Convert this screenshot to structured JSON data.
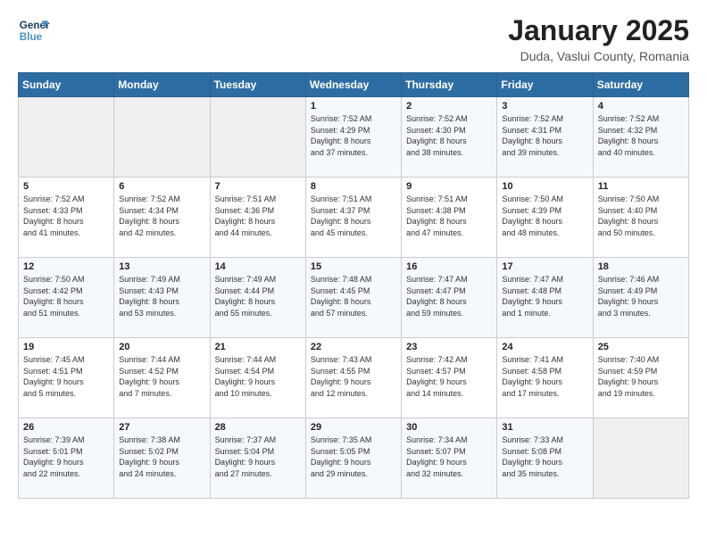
{
  "header": {
    "logo_line1": "General",
    "logo_line2": "Blue",
    "month": "January 2025",
    "location": "Duda, Vaslui County, Romania"
  },
  "days_of_week": [
    "Sunday",
    "Monday",
    "Tuesday",
    "Wednesday",
    "Thursday",
    "Friday",
    "Saturday"
  ],
  "weeks": [
    [
      {
        "day": "",
        "info": ""
      },
      {
        "day": "",
        "info": ""
      },
      {
        "day": "",
        "info": ""
      },
      {
        "day": "1",
        "info": "Sunrise: 7:52 AM\nSunset: 4:29 PM\nDaylight: 8 hours\nand 37 minutes."
      },
      {
        "day": "2",
        "info": "Sunrise: 7:52 AM\nSunset: 4:30 PM\nDaylight: 8 hours\nand 38 minutes."
      },
      {
        "day": "3",
        "info": "Sunrise: 7:52 AM\nSunset: 4:31 PM\nDaylight: 8 hours\nand 39 minutes."
      },
      {
        "day": "4",
        "info": "Sunrise: 7:52 AM\nSunset: 4:32 PM\nDaylight: 8 hours\nand 40 minutes."
      }
    ],
    [
      {
        "day": "5",
        "info": "Sunrise: 7:52 AM\nSunset: 4:33 PM\nDaylight: 8 hours\nand 41 minutes."
      },
      {
        "day": "6",
        "info": "Sunrise: 7:52 AM\nSunset: 4:34 PM\nDaylight: 8 hours\nand 42 minutes."
      },
      {
        "day": "7",
        "info": "Sunrise: 7:51 AM\nSunset: 4:36 PM\nDaylight: 8 hours\nand 44 minutes."
      },
      {
        "day": "8",
        "info": "Sunrise: 7:51 AM\nSunset: 4:37 PM\nDaylight: 8 hours\nand 45 minutes."
      },
      {
        "day": "9",
        "info": "Sunrise: 7:51 AM\nSunset: 4:38 PM\nDaylight: 8 hours\nand 47 minutes."
      },
      {
        "day": "10",
        "info": "Sunrise: 7:50 AM\nSunset: 4:39 PM\nDaylight: 8 hours\nand 48 minutes."
      },
      {
        "day": "11",
        "info": "Sunrise: 7:50 AM\nSunset: 4:40 PM\nDaylight: 8 hours\nand 50 minutes."
      }
    ],
    [
      {
        "day": "12",
        "info": "Sunrise: 7:50 AM\nSunset: 4:42 PM\nDaylight: 8 hours\nand 51 minutes."
      },
      {
        "day": "13",
        "info": "Sunrise: 7:49 AM\nSunset: 4:43 PM\nDaylight: 8 hours\nand 53 minutes."
      },
      {
        "day": "14",
        "info": "Sunrise: 7:49 AM\nSunset: 4:44 PM\nDaylight: 8 hours\nand 55 minutes."
      },
      {
        "day": "15",
        "info": "Sunrise: 7:48 AM\nSunset: 4:45 PM\nDaylight: 8 hours\nand 57 minutes."
      },
      {
        "day": "16",
        "info": "Sunrise: 7:47 AM\nSunset: 4:47 PM\nDaylight: 8 hours\nand 59 minutes."
      },
      {
        "day": "17",
        "info": "Sunrise: 7:47 AM\nSunset: 4:48 PM\nDaylight: 9 hours\nand 1 minute."
      },
      {
        "day": "18",
        "info": "Sunrise: 7:46 AM\nSunset: 4:49 PM\nDaylight: 9 hours\nand 3 minutes."
      }
    ],
    [
      {
        "day": "19",
        "info": "Sunrise: 7:45 AM\nSunset: 4:51 PM\nDaylight: 9 hours\nand 5 minutes."
      },
      {
        "day": "20",
        "info": "Sunrise: 7:44 AM\nSunset: 4:52 PM\nDaylight: 9 hours\nand 7 minutes."
      },
      {
        "day": "21",
        "info": "Sunrise: 7:44 AM\nSunset: 4:54 PM\nDaylight: 9 hours\nand 10 minutes."
      },
      {
        "day": "22",
        "info": "Sunrise: 7:43 AM\nSunset: 4:55 PM\nDaylight: 9 hours\nand 12 minutes."
      },
      {
        "day": "23",
        "info": "Sunrise: 7:42 AM\nSunset: 4:57 PM\nDaylight: 9 hours\nand 14 minutes."
      },
      {
        "day": "24",
        "info": "Sunrise: 7:41 AM\nSunset: 4:58 PM\nDaylight: 9 hours\nand 17 minutes."
      },
      {
        "day": "25",
        "info": "Sunrise: 7:40 AM\nSunset: 4:59 PM\nDaylight: 9 hours\nand 19 minutes."
      }
    ],
    [
      {
        "day": "26",
        "info": "Sunrise: 7:39 AM\nSunset: 5:01 PM\nDaylight: 9 hours\nand 22 minutes."
      },
      {
        "day": "27",
        "info": "Sunrise: 7:38 AM\nSunset: 5:02 PM\nDaylight: 9 hours\nand 24 minutes."
      },
      {
        "day": "28",
        "info": "Sunrise: 7:37 AM\nSunset: 5:04 PM\nDaylight: 9 hours\nand 27 minutes."
      },
      {
        "day": "29",
        "info": "Sunrise: 7:35 AM\nSunset: 5:05 PM\nDaylight: 9 hours\nand 29 minutes."
      },
      {
        "day": "30",
        "info": "Sunrise: 7:34 AM\nSunset: 5:07 PM\nDaylight: 9 hours\nand 32 minutes."
      },
      {
        "day": "31",
        "info": "Sunrise: 7:33 AM\nSunset: 5:08 PM\nDaylight: 9 hours\nand 35 minutes."
      },
      {
        "day": "",
        "info": ""
      }
    ]
  ]
}
